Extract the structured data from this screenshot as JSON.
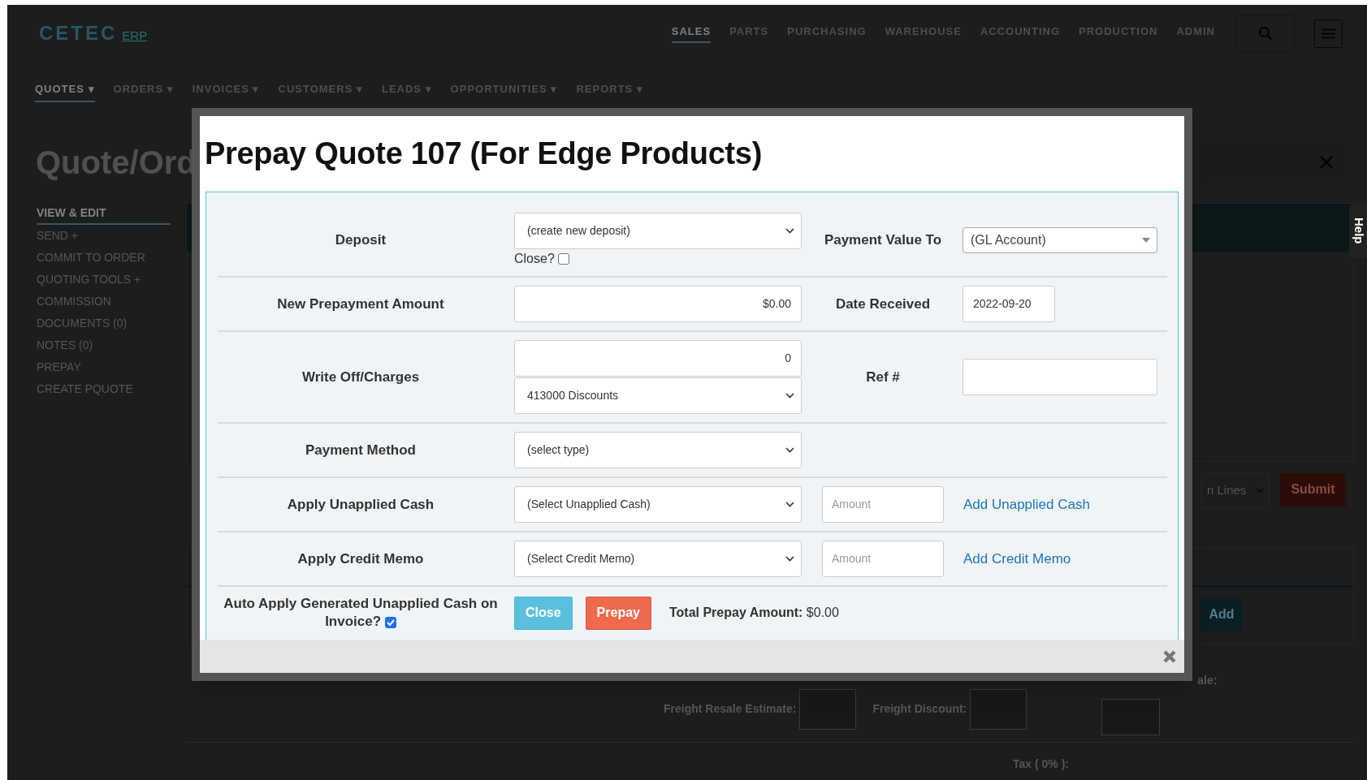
{
  "header": {
    "logo": "CETEC",
    "logo_suffix": "ERP",
    "nav": [
      {
        "label": "SALES",
        "selected": true
      },
      {
        "label": "PARTS",
        "selected": false
      },
      {
        "label": "PURCHASING",
        "selected": false
      },
      {
        "label": "WAREHOUSE",
        "selected": false
      },
      {
        "label": "ACCOUNTING",
        "selected": false
      },
      {
        "label": "PRODUCTION",
        "selected": false
      },
      {
        "label": "ADMIN",
        "selected": false
      }
    ]
  },
  "subnav": [
    {
      "label": "QUOTES ▾",
      "selected": true
    },
    {
      "label": "ORDERS ▾",
      "selected": false
    },
    {
      "label": "INVOICES ▾",
      "selected": false
    },
    {
      "label": "CUSTOMERS ▾",
      "selected": false
    },
    {
      "label": "LEADS ▾",
      "selected": false
    },
    {
      "label": "OPPORTUNITIES ▾",
      "selected": false
    },
    {
      "label": "REPORTS ▾",
      "selected": false
    }
  ],
  "page_title": "Quote/Ord",
  "sidebar": [
    {
      "label": "VIEW & EDIT",
      "selected": true
    },
    {
      "label": "SEND +",
      "selected": false
    },
    {
      "label": "COMMIT TO ORDER",
      "selected": false
    },
    {
      "label": "QUOTING TOOLS +",
      "selected": false
    },
    {
      "label": "COMMISSION",
      "selected": false
    },
    {
      "label": "DOCUMENTS (0)",
      "selected": false
    },
    {
      "label": "NOTES (0)",
      "selected": false
    },
    {
      "label": "PREPAY",
      "selected": false
    },
    {
      "label": "CREATE PQUOTE",
      "selected": false
    }
  ],
  "background": {
    "lines_select": "n Lines",
    "submit": "Submit",
    "add": "Add",
    "resale_label": "ale:",
    "freight_resale_label": "Freight Resale Estimate:",
    "freight_discount_label": "Freight Discount:",
    "tax_label": "Tax ( 0% ):"
  },
  "help_tab": "Help",
  "modal": {
    "title": "Prepay Quote 107 (For Edge Products)",
    "rows": [
      {
        "label": "Deposit",
        "main": [
          {
            "kind": "select",
            "value": "(create new deposit)"
          },
          {
            "kind": "checkbox",
            "label": "Close?",
            "checked": false
          }
        ],
        "side_label": "Payment Value To",
        "side": [
          {
            "kind": "combo",
            "value": "(GL Account)"
          }
        ]
      },
      {
        "label": "New Prepayment Amount",
        "main": [
          {
            "kind": "input",
            "value": "$0.00"
          }
        ],
        "side_label": "Date Received",
        "side": [
          {
            "kind": "date",
            "value": "2022-09-20"
          }
        ]
      },
      {
        "label": "Write Off/Charges",
        "main": [
          {
            "kind": "input",
            "value": "0"
          },
          {
            "kind": "select",
            "value": "413000 Discounts"
          }
        ],
        "side_label": "Ref #",
        "side": [
          {
            "kind": "input"
          }
        ]
      },
      {
        "label": "Payment Method",
        "main": [
          {
            "kind": "select",
            "value": "(select type)"
          }
        ]
      },
      {
        "label": "Apply Unapplied Cash",
        "main": [
          {
            "kind": "select",
            "value": "(Select Unapplied Cash)"
          }
        ],
        "side": [
          {
            "kind": "amount",
            "placeholder": "Amount"
          },
          {
            "kind": "link",
            "label": "Add Unapplied Cash"
          }
        ]
      },
      {
        "label": "Apply Credit Memo",
        "main": [
          {
            "kind": "select",
            "value": "(Select Credit Memo)"
          }
        ],
        "side": [
          {
            "kind": "amount",
            "placeholder": "Amount"
          },
          {
            "kind": "link",
            "label": "Add Credit Memo"
          }
        ]
      },
      {
        "label": "Auto Apply Generated Unapplied Cash on Invoice?",
        "label_checked": true,
        "main": [
          {
            "kind": "button",
            "label": "Close"
          },
          {
            "kind": "button",
            "label": "Prepay"
          },
          {
            "kind": "text",
            "text": "**Total Prepay Amount:** $0.00"
          }
        ]
      }
    ]
  }
}
